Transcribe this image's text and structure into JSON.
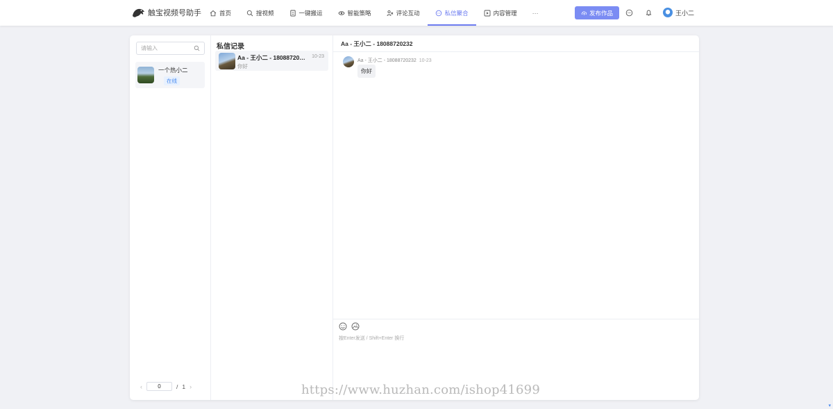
{
  "app": {
    "title": "触宝视频号助手"
  },
  "nav": [
    {
      "label": "首页",
      "icon": "home-icon",
      "active": false
    },
    {
      "label": "搜视频",
      "icon": "search-icon",
      "active": false
    },
    {
      "label": "一键搬运",
      "icon": "transfer-icon",
      "active": false
    },
    {
      "label": "智能策略",
      "icon": "strategy-icon",
      "active": false
    },
    {
      "label": "评论互动",
      "icon": "comment-icon",
      "active": false
    },
    {
      "label": "私信聚合",
      "icon": "message-icon",
      "active": true
    },
    {
      "label": "内容管理",
      "icon": "content-icon",
      "active": false
    }
  ],
  "nav_more": "···",
  "publish_label": "发布作品",
  "user_name": "王小二",
  "colors": {
    "accent": "#6d7cf0",
    "button": "#7b8cf3",
    "online_badge": "#4a8cf0"
  },
  "accounts": {
    "search_placeholder": "请输入",
    "items": [
      {
        "name": "一个热小二",
        "status": "在线"
      }
    ],
    "pager": {
      "prev": "‹",
      "next": "›",
      "current": "0",
      "separator": "/",
      "total": "1"
    }
  },
  "records": {
    "title": "私信记录",
    "items": [
      {
        "name": "Aa - 王小二 - 18088720232",
        "time": "10-23",
        "preview": "你好"
      }
    ]
  },
  "chat": {
    "title": "Aa - 王小二 - 18088720232",
    "messages": [
      {
        "sender": "Aa - 王小二 - 18088720232",
        "time": "10-23",
        "text": "你好"
      }
    ],
    "hint": "按Enter发送 / Shift+Enter 换行"
  },
  "watermark": "https://www.huzhan.com/ishop41699"
}
